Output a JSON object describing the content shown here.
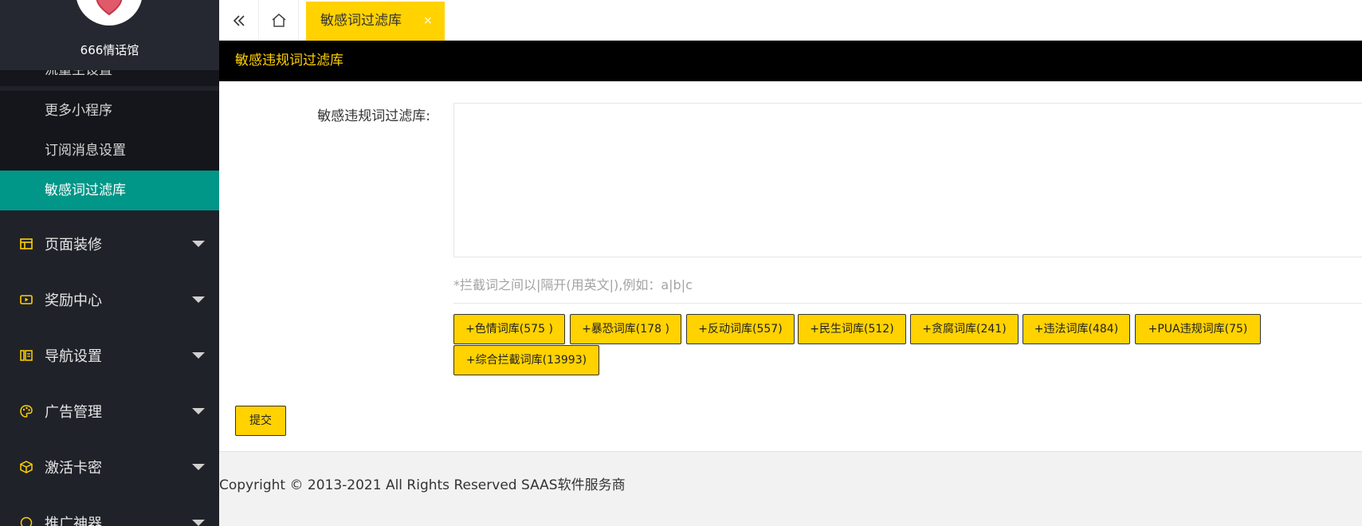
{
  "sidebar": {
    "brand_name": "666情话馆",
    "sub_items": [
      {
        "label": "流量主设置"
      },
      {
        "label": "更多小程序"
      },
      {
        "label": "订阅消息设置"
      },
      {
        "label": "敏感词过滤库"
      }
    ],
    "nav_items": [
      {
        "label": "页面装修",
        "icon": "layout-icon"
      },
      {
        "label": "奖励中心",
        "icon": "video-icon"
      },
      {
        "label": "导航设置",
        "icon": "nav-icon"
      },
      {
        "label": "广告管理",
        "icon": "palette-icon"
      },
      {
        "label": "激活卡密",
        "icon": "cube-icon"
      },
      {
        "label": "推广神器",
        "icon": "circle-icon"
      }
    ]
  },
  "topbar": {
    "active_tab": "敏感词过滤库",
    "close_glyph": "×"
  },
  "panel": {
    "header": "敏感违规词过滤库",
    "field_label": "敏感违规词过滤库:",
    "textarea_value": "",
    "hint": "*拦截词之间以|隔开(用英文|),例如：a|b|c",
    "library_buttons": [
      "+色情词库(575 )",
      "+暴恐词库(178 )",
      "+反动词库(557)",
      "+民生词库(512)",
      "+贪腐词库(241)",
      "+违法词库(484)",
      "+PUA违规词库(75)",
      "+综合拦截词库(13993)"
    ],
    "submit_label": "提交"
  },
  "footer": {
    "copyright": "Copyright © 2013-2021 All Rights Reserved SAAS软件服务商"
  },
  "colors": {
    "sidebar_bg": "#20222a",
    "active_green": "#009688",
    "accent_yellow": "#ffd200",
    "header_black": "#000000"
  }
}
